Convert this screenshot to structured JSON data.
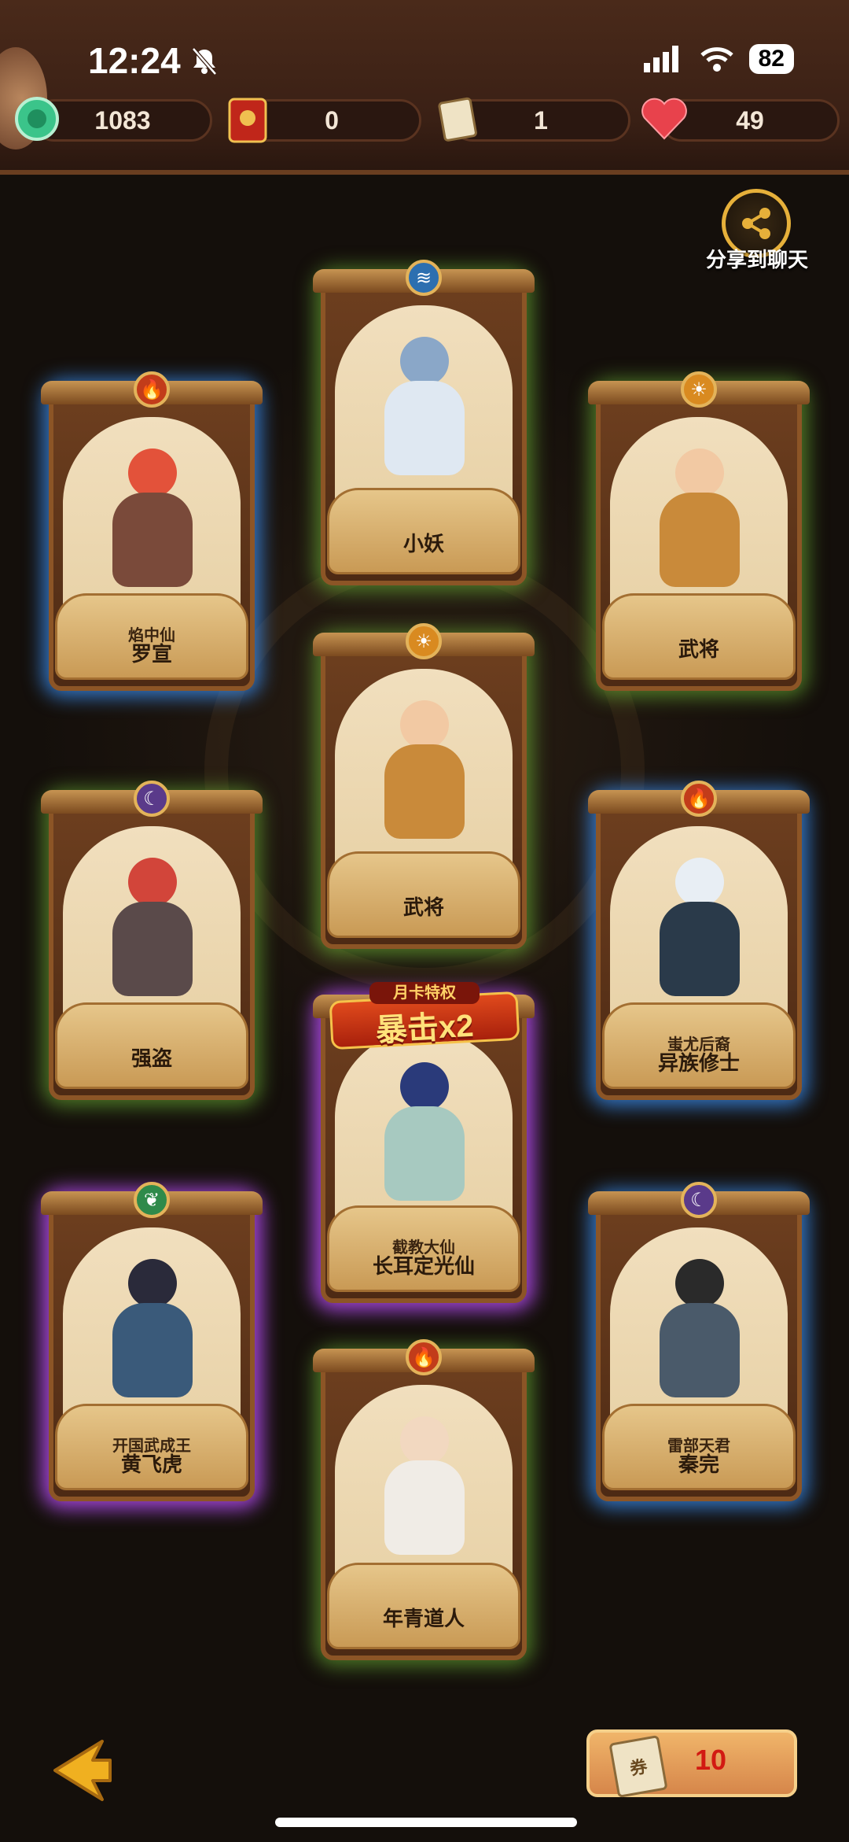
{
  "status_bar": {
    "time": "12:24",
    "battery": "82"
  },
  "resources": [
    {
      "icon": "jade-coin-icon",
      "value": "1083"
    },
    {
      "icon": "red-envelope-icon",
      "value": "0"
    },
    {
      "icon": "ticket-icon",
      "value": "1"
    },
    {
      "icon": "heart-icon",
      "value": "49"
    }
  ],
  "share": {
    "label": "分享到聊天"
  },
  "cards": [
    {
      "id": "xiaoyao",
      "title": "",
      "name": "小妖",
      "element": "water",
      "glow": "green"
    },
    {
      "id": "luoxuan",
      "title": "焰中仙",
      "name": "罗宣",
      "element": "fire",
      "glow": "blue"
    },
    {
      "id": "wujiang-top",
      "title": "",
      "name": "武将",
      "element": "sun",
      "glow": "green"
    },
    {
      "id": "wujiang-mid",
      "title": "",
      "name": "武将",
      "element": "sun",
      "glow": "green"
    },
    {
      "id": "qiangdao",
      "title": "",
      "name": "强盗",
      "element": "moon",
      "glow": "green"
    },
    {
      "id": "yizu",
      "title": "蚩尤后裔",
      "name": "异族修士",
      "element": "fire",
      "glow": "blue"
    },
    {
      "id": "changer",
      "title": "截教大仙",
      "name": "长耳定光仙",
      "element": "water",
      "glow": "purple"
    },
    {
      "id": "huangfeihu",
      "title": "开国武成王",
      "name": "黄飞虎",
      "element": "wood",
      "glow": "purple"
    },
    {
      "id": "qinwan",
      "title": "雷部天君",
      "name": "秦完",
      "element": "moon",
      "glow": "blue"
    },
    {
      "id": "nianqing",
      "title": "",
      "name": "年青道人",
      "element": "fire",
      "glow": "green"
    }
  ],
  "badge": {
    "top": "月卡特权",
    "main": "暴击x2"
  },
  "ticket_button": {
    "icon": "ticket-icon",
    "icon_label": "券",
    "count": "10"
  },
  "colors": {
    "accent": "#e6b03a",
    "header": "#3a2015",
    "background": "#140f0b"
  }
}
